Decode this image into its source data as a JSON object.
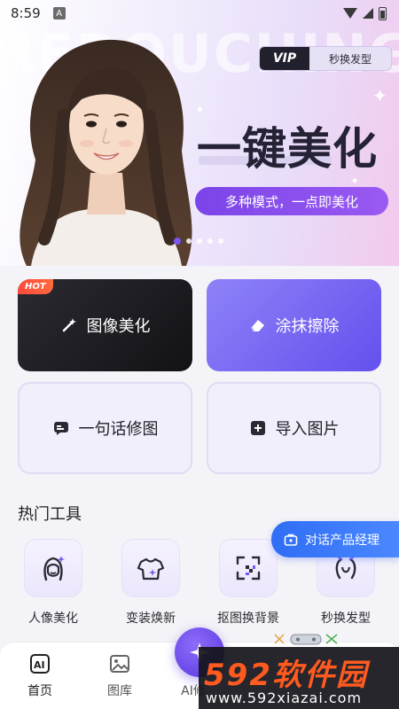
{
  "status_bar": {
    "time": "8:59",
    "notification_icon": "A"
  },
  "banner": {
    "background_text": "REDOUCHING",
    "vip_tag": "VIP",
    "vip_text": "秒换发型",
    "title": "一键美化",
    "pill_text": "多种模式，一点即美化",
    "carousel_count": 5,
    "carousel_active": 0
  },
  "tools": {
    "hot_badge": "HOT",
    "image_beautify": "图像美化",
    "erase": "涂抹擦除",
    "one_sentence": "一句话修图",
    "import_image": "导入图片"
  },
  "hot_section": {
    "title": "热门工具",
    "float_button": "对话产品经理",
    "items": [
      {
        "label": "人像美化",
        "icon": "portrait-icon"
      },
      {
        "label": "变装焕新",
        "icon": "shirt-icon"
      },
      {
        "label": "抠图换背景",
        "icon": "cutout-icon"
      },
      {
        "label": "秒换发型",
        "icon": "hairstyle-icon"
      }
    ]
  },
  "bottom_nav": {
    "home": "首页",
    "gallery": "图库",
    "ai": "AI修"
  },
  "watermark": {
    "brand": "592软件园",
    "url": "www.592xiazai.com"
  },
  "colors": {
    "accent": "#6f4bef",
    "dark_card": "#1b1b20",
    "float_button": "#3a7af7",
    "hot_badge": "#ff4a3d"
  }
}
